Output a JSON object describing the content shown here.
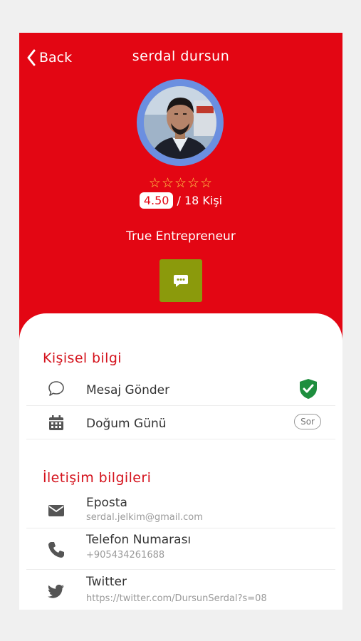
{
  "header": {
    "back_label": "Back",
    "title": "serdal dursun",
    "stars": "☆☆☆☆☆",
    "rating_value": "4.50",
    "rating_count": "/ 18 Kişi",
    "tagline": "True Entrepreneur",
    "accent_color": "#e30613",
    "chat_button_color": "#8b9a0c"
  },
  "personal": {
    "section_title": "Kişisel bilgi",
    "message_label": "Mesaj Gönder",
    "birthday_label": "Doğum Günü",
    "birthday_action": "Sor"
  },
  "contact": {
    "section_title": "İletişim bilgileri",
    "email_label": "Eposta",
    "email_value": "serdal.jelkim@gmail.com",
    "phone_label": "Telefon Numarası",
    "phone_value": "+905434261688",
    "twitter_label": "Twitter",
    "twitter_value": "https://twitter.com/DursunSerdal?s=08"
  },
  "icons": [
    "chevron-left-icon",
    "chat-icon",
    "message-bubble-icon",
    "shield-check-icon",
    "calendar-icon",
    "mail-icon",
    "phone-icon",
    "twitter-icon"
  ]
}
